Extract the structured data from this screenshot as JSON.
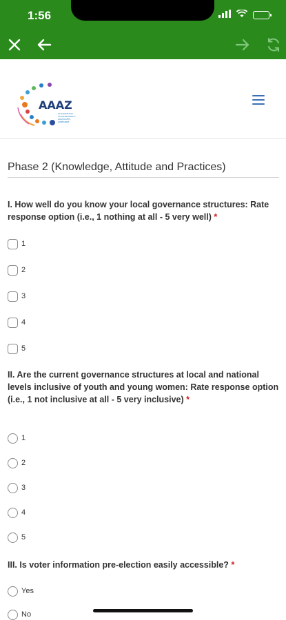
{
  "status_bar": {
    "time": "1:56"
  },
  "toolbar": {
    "close_icon": "close-icon",
    "back_icon": "arrow-left-icon",
    "forward_icon": "arrow-right-icon",
    "refresh_icon": "refresh-icon",
    "color": "#2a8a1c"
  },
  "header": {
    "logo_text": "AAAZ",
    "logo_subtext": "ALLIANCE FOR ACCOUNTABILITY ADVOCATES ZIMBABWE",
    "menu_icon": "hamburger-menu-icon"
  },
  "form": {
    "phase_title": "Phase 2 (Knowledge, Attitude and Practices)",
    "questions": [
      {
        "label": "I. How well do you know your local governance structures: Rate response option (i.e., 1 nothing at all - 5 very well)",
        "required_mark": "*",
        "type": "checkbox",
        "options": [
          "1",
          "2",
          "3",
          "4",
          "5"
        ]
      },
      {
        "label": "II. Are the current governance structures at local and national levels inclusive of youth and young women: Rate response option (i.e., 1 not inclusive at all - 5 very inclusive)",
        "required_mark": "*",
        "type": "radio",
        "options": [
          "1",
          "2",
          "3",
          "4",
          "5"
        ]
      },
      {
        "label": "III. Is voter information pre-election easily accessible?",
        "required_mark": "*",
        "type": "radio",
        "options": [
          "Yes",
          "No"
        ]
      }
    ]
  }
}
